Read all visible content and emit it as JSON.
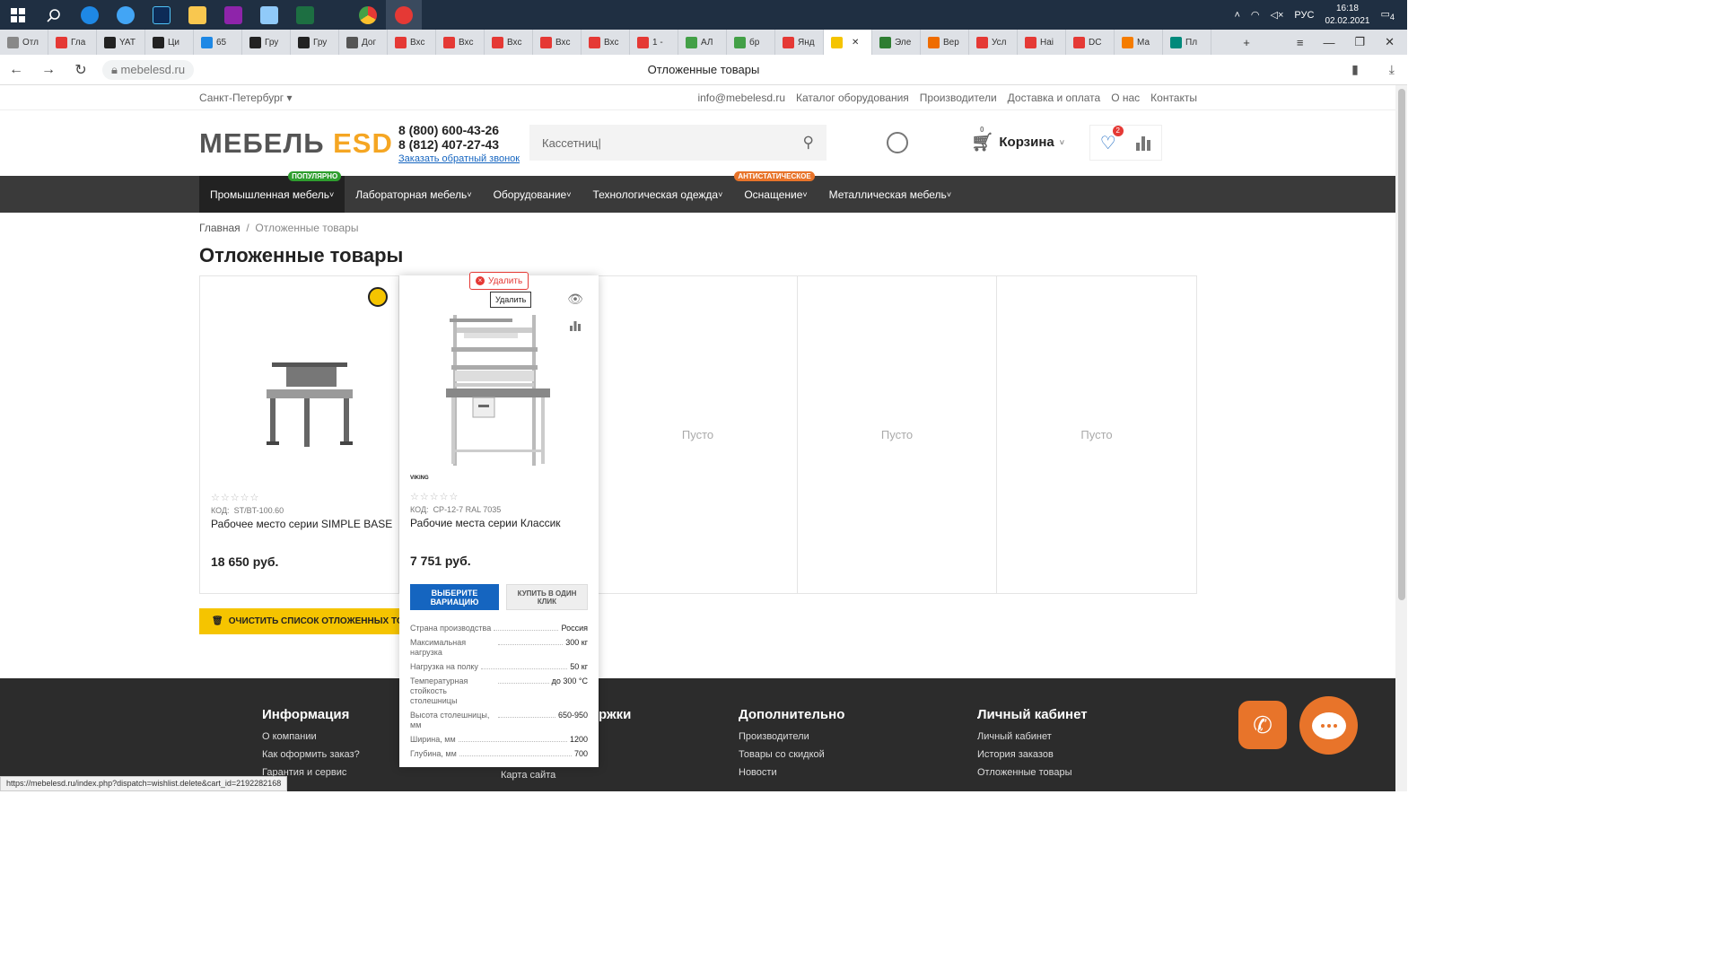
{
  "os_taskbar": {
    "lang": "РУС",
    "time": "16:18",
    "date": "02.02.2021",
    "notifications": "4"
  },
  "browser": {
    "tabs": [
      {
        "label": "Отл",
        "color": "#888"
      },
      {
        "label": "Гла",
        "color": "#e53935"
      },
      {
        "label": "YAT",
        "color": "#222"
      },
      {
        "label": "Ци",
        "color": "#222"
      },
      {
        "label": "65",
        "color": "#1e88e5"
      },
      {
        "label": "Гру",
        "color": "#222"
      },
      {
        "label": "Гру",
        "color": "#222"
      },
      {
        "label": "Дог",
        "color": "#555"
      },
      {
        "label": "Вхс",
        "color": "#e53935"
      },
      {
        "label": "Вхс",
        "color": "#e53935"
      },
      {
        "label": "Вхс",
        "color": "#e53935"
      },
      {
        "label": "Вхс",
        "color": "#e53935"
      },
      {
        "label": "Вхс",
        "color": "#e53935"
      },
      {
        "label": "1 -",
        "color": "#e53935"
      },
      {
        "label": "АЛ",
        "color": "#43a047"
      },
      {
        "label": "бр",
        "color": "#43a047"
      },
      {
        "label": "Янд",
        "color": "#e53935"
      },
      {
        "label": "",
        "color": "#f5c400",
        "active": true
      },
      {
        "label": "Эле",
        "color": "#2e7d32"
      },
      {
        "label": "Вер",
        "color": "#ef6c00"
      },
      {
        "label": "Усл",
        "color": "#e53935"
      },
      {
        "label": "Наі",
        "color": "#e53935"
      },
      {
        "label": "DC",
        "color": "#e53935"
      },
      {
        "label": "Ма",
        "color": "#f57c00"
      },
      {
        "label": "Пл",
        "color": "#00897b"
      }
    ],
    "url": "mebelesd.ru",
    "page_title": "Отложенные товары",
    "status_url": "https://mebelesd.ru/index.php?dispatch=wishlist.delete&cart_id=2192282168"
  },
  "topbar": {
    "city": "Санкт-Петербург",
    "links": [
      "info@mebelesd.ru",
      "Каталог оборудования",
      "Производители",
      "Доставка и оплата",
      "О нас",
      "Контакты"
    ]
  },
  "header": {
    "logo_a": "МЕБЕЛЬ",
    "logo_b": "ESD",
    "phone1": "8 (800) 600-43-26",
    "phone2": "8 (812) 407-27-43",
    "callback": "Заказать обратный звонок",
    "search_value": "Кассетниц",
    "cart_label": "Корзина",
    "cart_count": "0",
    "wish_count": "2"
  },
  "menu": [
    {
      "label": "Промышленная мебель",
      "badge": "ПОПУЛЯРНО",
      "badge_color": "#2e9e2e"
    },
    {
      "label": "Лабораторная мебель",
      "badge": "",
      "badge_color": ""
    },
    {
      "label": "Оборудование",
      "badge": "",
      "badge_color": ""
    },
    {
      "label": "Технологическая одежда",
      "badge": "",
      "badge_color": ""
    },
    {
      "label": "Оснащение",
      "badge": "АНТИСТАТИЧЕСКОЕ",
      "badge_color": "#e8742a"
    },
    {
      "label": "Металлическая мебель",
      "badge": "",
      "badge_color": ""
    }
  ],
  "breadcrumbs": {
    "home": "Главная",
    "sep": "/",
    "current": "Отложенные товары"
  },
  "page": {
    "heading": "Отложенные товары",
    "empty_label": "Пусто",
    "clear_button": "ОЧИСТИТЬ СПИСОК ОТЛОЖЕННЫХ ТОВАРОВ"
  },
  "products": [
    {
      "code_label": "КОД:",
      "code": "ST/BT-100.60",
      "name": "Рабочее место серии SIMPLE BASE",
      "price": "18 650 руб.",
      "stars": "☆☆☆☆☆"
    },
    {
      "code_label": "КОД:",
      "code": "CP-12-7 RAL 7035",
      "name": "Рабочие места серии Классик",
      "price": "7 751 руб.",
      "stars": "☆☆☆☆☆",
      "brand": "VIKING",
      "delete_label": "Удалить",
      "tooltip": "Удалить",
      "btn_variation": "ВЫБЕРИТЕ ВАРИАЦИЮ",
      "btn_oneclick": "КУПИТЬ В ОДИН КЛИК",
      "specs": [
        {
          "k": "Страна производства",
          "v": "Россия"
        },
        {
          "k": "Максимальная нагрузка",
          "v": "300 кг"
        },
        {
          "k": "Нагрузка на полку",
          "v": "50 кг"
        },
        {
          "k": "Температурная стойкость столешницы",
          "v": "до 300 °C"
        },
        {
          "k": "Высота столешницы, мм",
          "v": "650-950"
        },
        {
          "k": "Ширина, мм",
          "v": "1200"
        },
        {
          "k": "Глубина, мм",
          "v": "700"
        }
      ]
    }
  ],
  "footer": {
    "col1": {
      "title": "Информация",
      "links": [
        "О компании",
        "Как оформить заказ?",
        "Гарантия и сервис"
      ]
    },
    "col2": {
      "title": "ржки",
      "links": [
        "",
        "",
        "Карта сайта"
      ]
    },
    "col3": {
      "title": "Дополнительно",
      "links": [
        "Производители",
        "Товары со скидкой",
        "Новости"
      ]
    },
    "col4": {
      "title": "Личный кабинет",
      "links": [
        "Личный кабинет",
        "История заказов",
        "Отложенные товары"
      ]
    }
  }
}
